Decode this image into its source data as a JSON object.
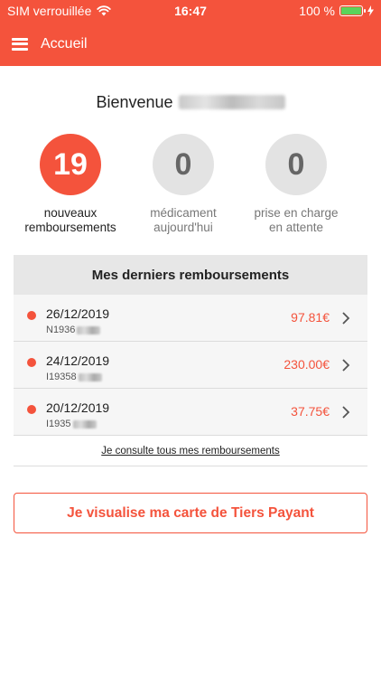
{
  "status_bar": {
    "carrier": "SIM verrouillée",
    "time": "16:47",
    "battery_percent": "100 %",
    "battery_level": 1.0,
    "icons": [
      "wifi-icon",
      "battery-icon",
      "charging-bolt-icon"
    ]
  },
  "nav": {
    "title": "Accueil",
    "menu_icon": "hamburger-menu-icon"
  },
  "welcome": {
    "text": "Bienvenue"
  },
  "stats": [
    {
      "value": "19",
      "label_line1": "nouveaux",
      "label_line2": "remboursements"
    },
    {
      "value": "0",
      "label_line1": "médicament",
      "label_line2": "aujourd'hui"
    },
    {
      "value": "0",
      "label_line1": "prise en charge",
      "label_line2": "en attente"
    }
  ],
  "reimbursements": {
    "header": "Mes derniers remboursements",
    "items": [
      {
        "date": "26/12/2019",
        "ref": "N1936",
        "amount": "97.81€"
      },
      {
        "date": "24/12/2019",
        "ref": "I19358",
        "amount": "230.00€"
      },
      {
        "date": "20/12/2019",
        "ref": "I1935",
        "amount": "37.75€"
      }
    ],
    "see_all": "Je consulte tous mes remboursements"
  },
  "tiers_payant_button": "Je visualise ma carte de Tiers Payant",
  "colors": {
    "accent": "#f4533c",
    "grey_circle": "#e3e3e3",
    "card_header": "#e7e7e7",
    "row_bg": "#f6f6f6"
  }
}
